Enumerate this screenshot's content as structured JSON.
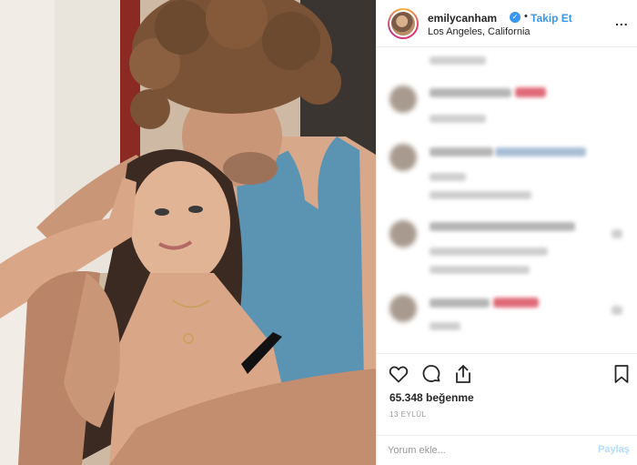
{
  "post": {
    "username": "emilycanham",
    "verified_icon": "verified-badge-icon",
    "separator": "•",
    "follow_label": "Takip Et",
    "location": "Los Angeles, California",
    "more_label": "..."
  },
  "actions": {
    "icons": [
      "heart-icon",
      "comment-icon",
      "share-icon",
      "bookmark-icon"
    ],
    "likes": "65.348 beğenme",
    "date": "13 EYLÜL"
  },
  "comment_box": {
    "placeholder": "Yorum ekle...",
    "post_label": "Paylaş"
  },
  "colors": {
    "accent": "#3897f0",
    "post_disabled": "#b3dbff",
    "border": "#efefef",
    "text": "#262626"
  }
}
